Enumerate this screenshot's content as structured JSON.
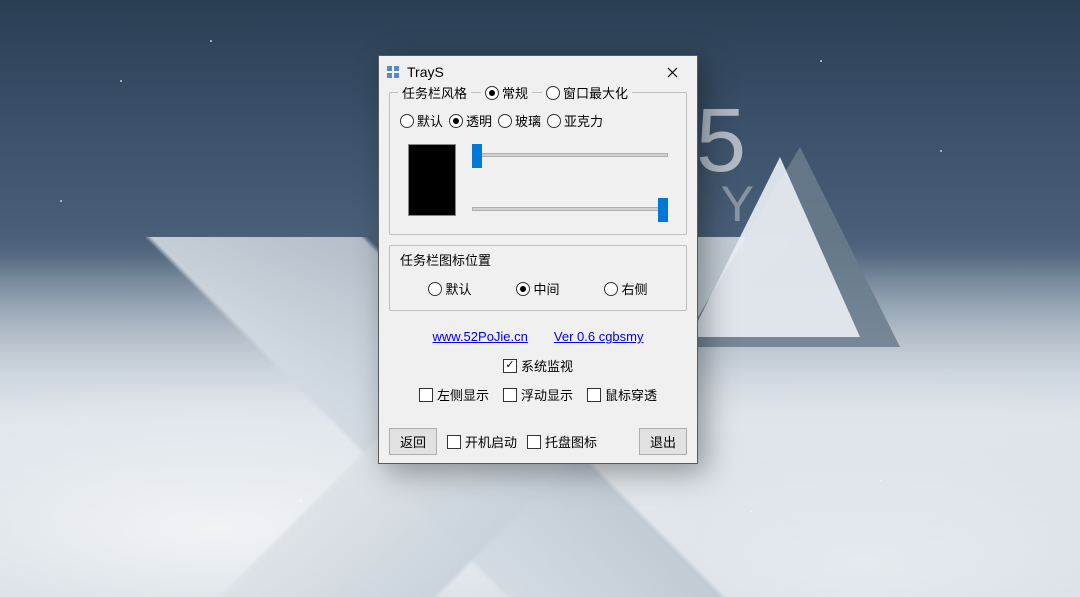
{
  "window": {
    "title": "TrayS"
  },
  "taskbarStyle": {
    "groupTitle": "任务栏风格",
    "mode": [
      {
        "label": "常规",
        "selected": true
      },
      {
        "label": "窗口最大化",
        "selected": false
      }
    ],
    "styles": [
      {
        "label": "默认",
        "selected": false
      },
      {
        "label": "透明",
        "selected": true
      },
      {
        "label": "玻璃",
        "selected": false
      },
      {
        "label": "亚克力",
        "selected": false
      }
    ],
    "swatchColor": "#000000",
    "slider1": {
      "min": 0,
      "max": 100,
      "value": 2
    },
    "slider2": {
      "min": 0,
      "max": 100,
      "value": 100
    }
  },
  "iconPosition": {
    "groupTitle": "任务栏图标位置",
    "options": [
      {
        "label": "默认",
        "selected": false
      },
      {
        "label": "中间",
        "selected": true
      },
      {
        "label": "右侧",
        "selected": false
      }
    ]
  },
  "links": {
    "site": "www.52PoJie.cn",
    "version": "Ver 0.6 cgbsmy"
  },
  "monitor": {
    "systemMonitor": {
      "label": "系统监视",
      "checked": true
    },
    "options": [
      {
        "label": "左侧显示",
        "checked": false
      },
      {
        "label": "浮动显示",
        "checked": false
      },
      {
        "label": "鼠标穿透",
        "checked": false
      }
    ]
  },
  "footer": {
    "back": "返回",
    "startup": {
      "label": "开机启动",
      "checked": false
    },
    "trayIcon": {
      "label": "托盘图标",
      "checked": false
    },
    "exit": "退出"
  },
  "background": {
    "time": "5",
    "day": "Y"
  }
}
